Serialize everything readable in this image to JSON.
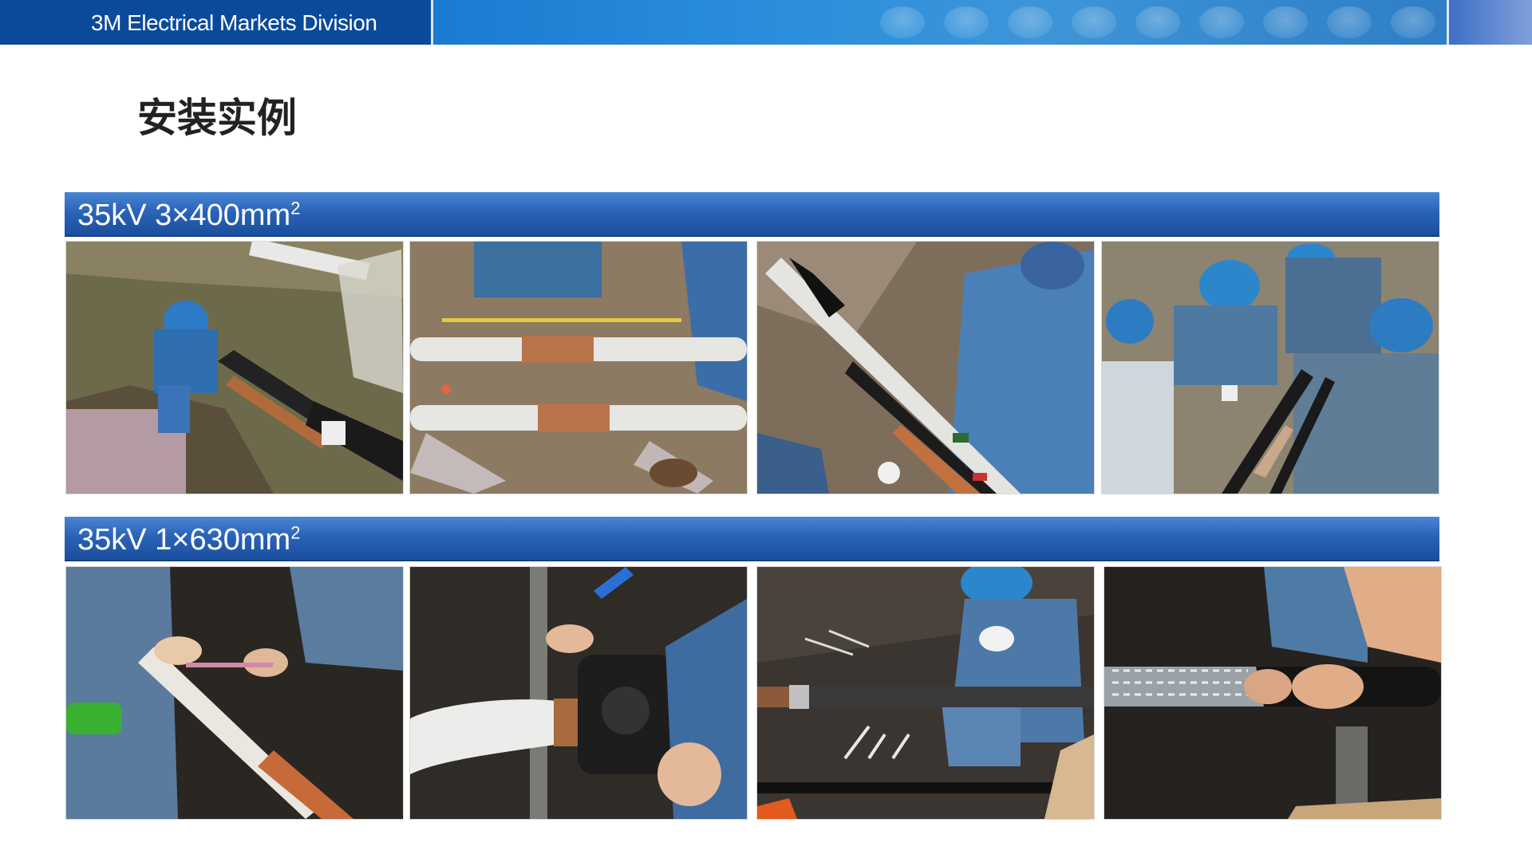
{
  "header": {
    "division_name": "3M Electrical Markets Division"
  },
  "page": {
    "title": "安装实例"
  },
  "sections": [
    {
      "label_main": "35kV 3×400mm",
      "label_sup": "2"
    },
    {
      "label_main": "35kV 1×630mm",
      "label_sup": "2"
    }
  ],
  "colors": {
    "header_blue": "#0b4a9a",
    "section_blue": "#2a63b8",
    "workwear_blue": "#3a73b8"
  }
}
